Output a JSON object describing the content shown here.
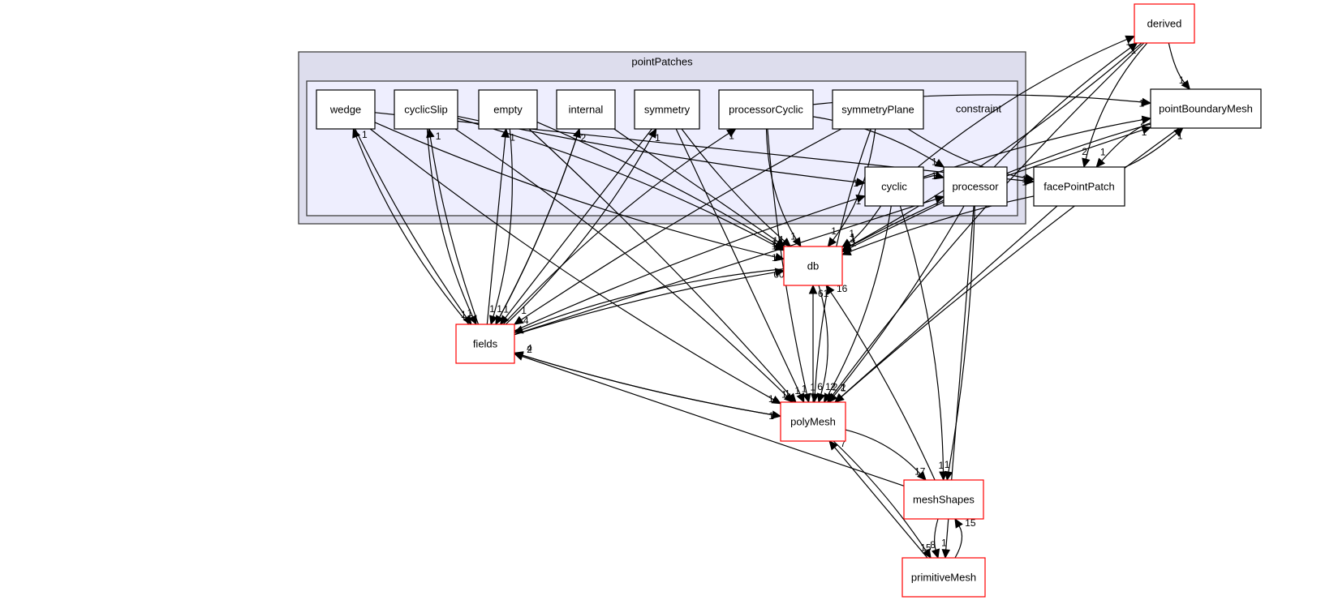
{
  "clusters": {
    "outer": {
      "id": "pointPatches",
      "label": "pointPatches"
    },
    "inner": {
      "id": "constraint",
      "label": "constraint"
    }
  },
  "nodes": [
    {
      "id": "wedge",
      "label": "wedge",
      "group": "constraint",
      "external": false
    },
    {
      "id": "cyclicSlip",
      "label": "cyclicSlip",
      "group": "constraint",
      "external": false
    },
    {
      "id": "empty",
      "label": "empty",
      "group": "constraint",
      "external": false
    },
    {
      "id": "internal",
      "label": "internal",
      "group": "constraint",
      "external": false
    },
    {
      "id": "symmetry",
      "label": "symmetry",
      "group": "constraint",
      "external": false
    },
    {
      "id": "processorCyclic",
      "label": "processorCyclic",
      "group": "constraint",
      "external": false
    },
    {
      "id": "symmetryPlane",
      "label": "symmetryPlane",
      "group": "constraint",
      "external": false
    },
    {
      "id": "cyclic",
      "label": "cyclic",
      "group": "constraint",
      "external": false
    },
    {
      "id": "processor",
      "label": "processor",
      "group": "constraint",
      "external": false
    },
    {
      "id": "derived",
      "label": "derived",
      "group": "",
      "external": true
    },
    {
      "id": "pointBoundaryMesh",
      "label": "pointBoundaryMesh",
      "group": "",
      "external": false
    },
    {
      "id": "facePointPatch",
      "label": "facePointPatch",
      "group": "",
      "external": false
    },
    {
      "id": "db",
      "label": "db",
      "group": "",
      "external": true
    },
    {
      "id": "fields",
      "label": "fields",
      "group": "",
      "external": true
    },
    {
      "id": "polyMesh",
      "label": "polyMesh",
      "group": "",
      "external": true
    },
    {
      "id": "meshShapes",
      "label": "meshShapes",
      "group": "",
      "external": true
    },
    {
      "id": "primitiveMesh",
      "label": "primitiveMesh",
      "group": "",
      "external": true
    }
  ],
  "edges": [
    {
      "from": "fields",
      "to": "wedge",
      "label": "1"
    },
    {
      "from": "fields",
      "to": "cyclicSlip",
      "label": "1"
    },
    {
      "from": "fields",
      "to": "empty",
      "label": "1"
    },
    {
      "from": "fields",
      "to": "internal",
      "label": "2"
    },
    {
      "from": "fields",
      "to": "symmetry",
      "label": "1"
    },
    {
      "from": "fields",
      "to": "processorCyclic",
      "label": "1"
    },
    {
      "from": "fields",
      "to": "cyclic",
      "label": "1"
    },
    {
      "from": "fields",
      "to": "processor",
      "label": "1"
    },
    {
      "from": "wedge",
      "to": "fields",
      "label": "1"
    },
    {
      "from": "cyclicSlip",
      "to": "fields",
      "label": "1"
    },
    {
      "from": "empty",
      "to": "fields",
      "label": "1"
    },
    {
      "from": "internal",
      "to": "fields",
      "label": "1"
    },
    {
      "from": "symmetry",
      "to": "fields",
      "label": "1"
    },
    {
      "from": "symmetryPlane",
      "to": "fields",
      "label": "1"
    },
    {
      "from": "wedge",
      "to": "db",
      "label": "1"
    },
    {
      "from": "cyclicSlip",
      "to": "db",
      "label": "1"
    },
    {
      "from": "empty",
      "to": "db",
      "label": "1"
    },
    {
      "from": "internal",
      "to": "db",
      "label": "1"
    },
    {
      "from": "symmetry",
      "to": "db",
      "label": "1"
    },
    {
      "from": "processorCyclic",
      "to": "db",
      "label": "1"
    },
    {
      "from": "symmetryPlane",
      "to": "db",
      "label": "1"
    },
    {
      "from": "cyclic",
      "to": "db",
      "label": "1"
    },
    {
      "from": "processor",
      "to": "db",
      "label": "1"
    },
    {
      "from": "facePointPatch",
      "to": "db",
      "label": "1"
    },
    {
      "from": "pointBoundaryMesh",
      "to": "db",
      "label": "1"
    },
    {
      "from": "derived",
      "to": "db",
      "label": "1"
    },
    {
      "from": "fields",
      "to": "db",
      "label": "60"
    },
    {
      "from": "polyMesh",
      "to": "db",
      "label": "61"
    },
    {
      "from": "meshShapes",
      "to": "db",
      "label": "16"
    },
    {
      "from": "db",
      "to": "fields",
      "label": "4"
    },
    {
      "from": "db",
      "to": "polyMesh",
      "label": "6"
    },
    {
      "from": "polyMesh",
      "to": "fields",
      "label": "4"
    },
    {
      "from": "meshShapes",
      "to": "fields",
      "label": "2"
    },
    {
      "from": "fields",
      "to": "polyMesh",
      "label": "1"
    },
    {
      "from": "wedge",
      "to": "polyMesh",
      "label": "1"
    },
    {
      "from": "cyclicSlip",
      "to": "polyMesh",
      "label": "1"
    },
    {
      "from": "empty",
      "to": "polyMesh",
      "label": "1"
    },
    {
      "from": "symmetry",
      "to": "polyMesh",
      "label": "1"
    },
    {
      "from": "processorCyclic",
      "to": "polyMesh",
      "label": "1"
    },
    {
      "from": "symmetryPlane",
      "to": "polyMesh",
      "label": "1"
    },
    {
      "from": "cyclic",
      "to": "polyMesh",
      "label": "1"
    },
    {
      "from": "processor",
      "to": "polyMesh",
      "label": "2"
    },
    {
      "from": "facePointPatch",
      "to": "polyMesh",
      "label": "2"
    },
    {
      "from": "pointBoundaryMesh",
      "to": "polyMesh",
      "label": "1"
    },
    {
      "from": "derived",
      "to": "polyMesh",
      "label": "2"
    },
    {
      "from": "polyMesh",
      "to": "meshShapes",
      "label": "17"
    },
    {
      "from": "polyMesh",
      "to": "primitiveMesh",
      "label": "15"
    },
    {
      "from": "primitiveMesh",
      "to": "polyMesh",
      "label": "7"
    },
    {
      "from": "meshShapes",
      "to": "primitiveMesh",
      "label": "8"
    },
    {
      "from": "primitiveMesh",
      "to": "meshShapes",
      "label": "15"
    },
    {
      "from": "cyclic",
      "to": "meshShapes",
      "label": "1"
    },
    {
      "from": "processor",
      "to": "meshShapes",
      "label": "1"
    },
    {
      "from": "processor",
      "to": "primitiveMesh",
      "label": "1"
    },
    {
      "from": "derived",
      "to": "pointBoundaryMesh",
      "label": "1"
    },
    {
      "from": "derived",
      "to": "facePointPatch",
      "label": "2"
    },
    {
      "from": "processorCyclic",
      "to": "pointBoundaryMesh",
      "label": "1"
    },
    {
      "from": "cyclic",
      "to": "pointBoundaryMesh",
      "label": "2"
    },
    {
      "from": "processor",
      "to": "pointBoundaryMesh",
      "label": "1"
    },
    {
      "from": "facePointPatch",
      "to": "pointBoundaryMesh",
      "label": "1"
    },
    {
      "from": "pointBoundaryMesh",
      "to": "facePointPatch",
      "label": "1"
    },
    {
      "from": "cyclic",
      "to": "derived",
      "label": "1"
    },
    {
      "from": "processor",
      "to": "derived",
      "label": "1"
    },
    {
      "from": "wedge",
      "to": "facePointPatch",
      "label": "1"
    },
    {
      "from": "cyclicSlip",
      "to": "cyclic",
      "label": "1"
    },
    {
      "from": "symmetryPlane",
      "to": "facePointPatch",
      "label": "1"
    },
    {
      "from": "processorCyclic",
      "to": "processor",
      "label": "1"
    },
    {
      "from": "cyclic",
      "to": "processor",
      "label": "1"
    }
  ]
}
